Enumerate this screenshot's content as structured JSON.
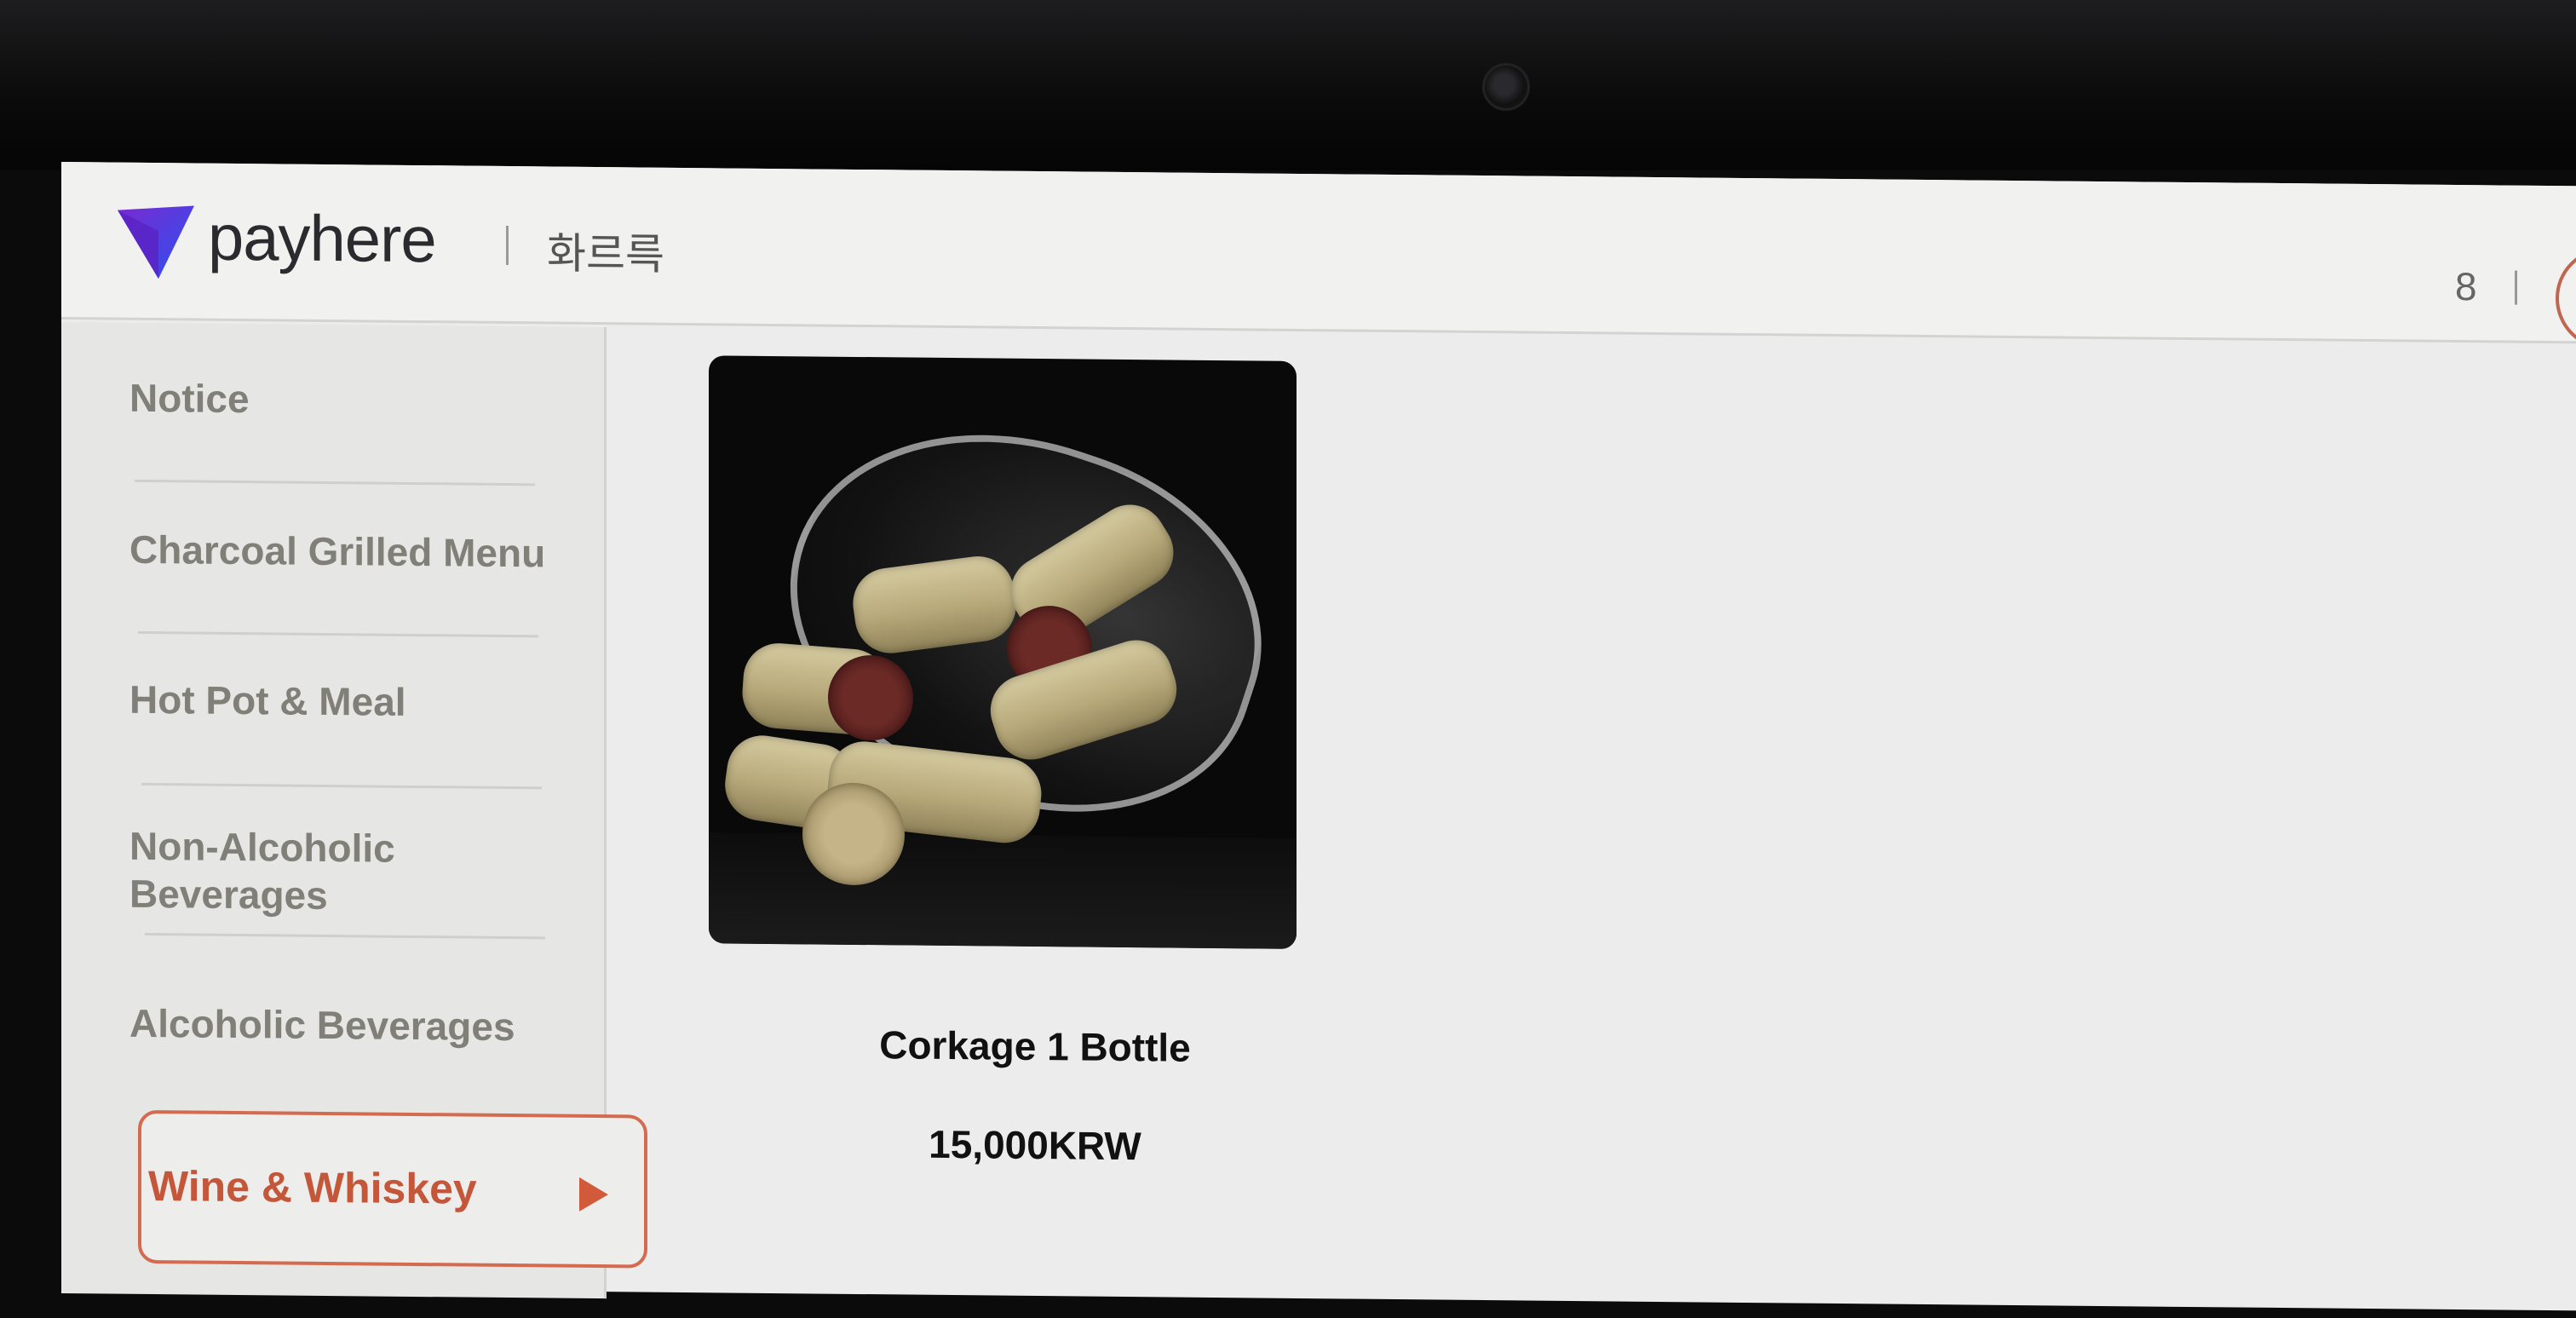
{
  "header": {
    "brand_name": "payhere",
    "store_name": "화르륵",
    "table_number": "8",
    "brand_icon": "payhere-logo-icon"
  },
  "sidebar": {
    "items": [
      {
        "label": "Notice"
      },
      {
        "label": "Charcoal Grilled Menu"
      },
      {
        "label": "Hot Pot & Meal"
      },
      {
        "label": "Non-Alcoholic\nBeverages"
      },
      {
        "label": "Alcoholic Beverages"
      },
      {
        "label": "Wine & Whiskey",
        "selected": true
      }
    ],
    "active_icon": "triangle-right-icon"
  },
  "products": [
    {
      "name": "Corkage 1 Bottle",
      "price": "15,000KRW",
      "image": "wine-corks-in-glass"
    }
  ],
  "colors": {
    "accent": "#d15a3b",
    "brand_blue": "#3d3be6",
    "brand_purple": "#7a2ad1"
  }
}
